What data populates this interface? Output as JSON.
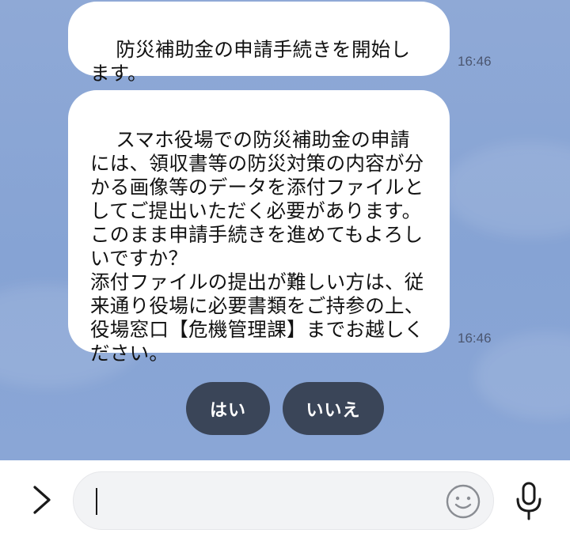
{
  "chat": {
    "messages": [
      {
        "text": "防災補助金の申請手続きを開始します。",
        "time": "16:46"
      },
      {
        "text": "スマホ役場での防災補助金の申請には、領収書等の防災対策の内容が分かる画像等のデータを添付ファイルとしてご提出いただく必要があります。このまま申請手続きを進めてもよろしいですか？\n添付ファイルの提出が難しい方は、従来通り役場に必要書類をご持参の上、役場窓口【危機管理課】までお越しください。",
        "time": "16:46"
      }
    ],
    "quick_replies": [
      {
        "label": "はい"
      },
      {
        "label": "いいえ"
      }
    ]
  },
  "input_bar": {
    "value": "",
    "placeholder": "",
    "icons": {
      "expand": "chevron-right-icon",
      "emoji": "smiley-icon",
      "mic": "microphone-icon"
    }
  },
  "colors": {
    "chat_background": "#8aa6d6",
    "bubble": "#ffffff",
    "quick_reply": "#3a4558",
    "timestamp": "#4b5670"
  }
}
